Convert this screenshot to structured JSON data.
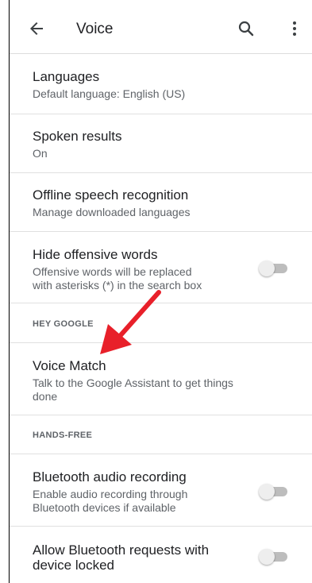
{
  "appbar": {
    "title": "Voice",
    "back_icon": "arrow-back-icon",
    "search_icon": "search-icon",
    "more_icon": "more-vert-icon"
  },
  "items": {
    "languages": {
      "title": "Languages",
      "subtitle": "Default language: English (US)"
    },
    "spoken_results": {
      "title": "Spoken results",
      "subtitle": "On"
    },
    "offline": {
      "title": "Offline speech recognition",
      "subtitle": "Manage downloaded languages"
    },
    "hide_offensive": {
      "title": "Hide offensive words",
      "subtitle_line1": "Offensive words will be replaced",
      "subtitle_line2": "with asterisks (*) in the search box",
      "enabled": false
    },
    "voice_match": {
      "title": "Voice Match",
      "subtitle_line1": "Talk to the Google Assistant to get things",
      "subtitle_line2": "done"
    },
    "bluetooth_audio": {
      "title": "Bluetooth audio recording",
      "subtitle_line1": "Enable audio recording through",
      "subtitle_line2": "Bluetooth devices if available",
      "enabled": false
    },
    "bluetooth_requests": {
      "title_line1": "Allow Bluetooth requests with",
      "title_line2": "device locked",
      "enabled": false
    }
  },
  "sections": {
    "hey_google": "HEY GOOGLE",
    "hands_free": "HANDS-FREE"
  },
  "colors": {
    "annotation_arrow": "#e8202a",
    "toggle_track_off": "#bdbdbd",
    "toggle_knob_off": "#eeeeee"
  }
}
